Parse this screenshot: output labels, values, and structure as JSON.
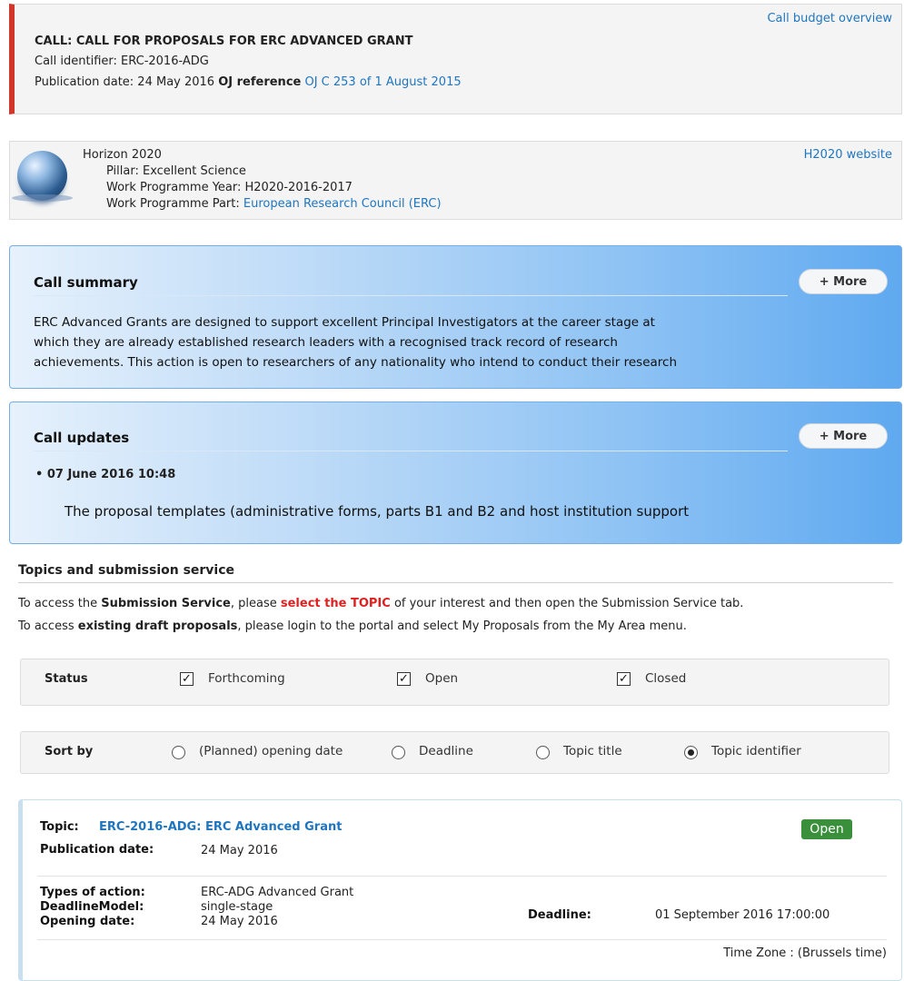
{
  "call": {
    "budget_link": "Call budget overview",
    "title": "CALL: CALL FOR PROPOSALS FOR ERC ADVANCED GRANT",
    "identifier": "Call identifier: ERC-2016-ADG",
    "publication_prefix": "Publication date: 24 May 2016",
    "oj_label": "OJ reference",
    "oj_link": "OJ C 253 of 1 August 2015"
  },
  "programme": {
    "name": "Horizon 2020",
    "pillar": "Pillar: Excellent Science",
    "wp_year": "Work Programme Year: H2020-2016-2017",
    "wp_part_label": "Work Programme Part:",
    "wp_part_link": "European Research Council (ERC)",
    "website_link": "H2020 website",
    "logo_icon": "globe-icon"
  },
  "call_summary": {
    "title": "Call summary",
    "more": "+ More",
    "lines": [
      "ERC Advanced Grants are designed to support excellent Principal Investigators at the career stage at",
      "which they are already established research leaders with a recognised track record of research",
      "achievements. This action is open to researchers of any nationality who intend to conduct their research"
    ]
  },
  "call_updates": {
    "title": "Call updates",
    "more": "+ More",
    "date": "07 June 2016 10:48",
    "text": "The proposal templates (administrative forms, parts B1 and B2 and host institution support"
  },
  "topics": {
    "title": "Topics and submission service",
    "info1_a": "To access the",
    "info1_b": "Submission Service",
    "info1_c": ", please",
    "info1_d": "select the TOPIC",
    "info1_e": "of your interest and then open the Submission Service tab.",
    "info2_a": "To access",
    "info2_b": "existing draft proposals",
    "info2_c": ", please login to the portal and select My Proposals from the My Area menu."
  },
  "status_filter": {
    "label": "Status",
    "options": [
      {
        "label": "Forthcoming",
        "checked": true
      },
      {
        "label": "Open",
        "checked": true
      },
      {
        "label": "Closed",
        "checked": true
      }
    ]
  },
  "sort_filter": {
    "label": "Sort by",
    "options": [
      {
        "label": "(Planned) opening date",
        "selected": false
      },
      {
        "label": "Deadline",
        "selected": false
      },
      {
        "label": "Topic title",
        "selected": false
      },
      {
        "label": "Topic identifier",
        "selected": true
      }
    ]
  },
  "topic": {
    "topic_label": "Topic:",
    "topic_link": "ERC-2016-ADG: ERC Advanced Grant",
    "status_badge": "Open",
    "publication_label": "Publication date:",
    "publication_value": "24 May 2016",
    "types_label": "Types of action:",
    "types_value": "ERC-ADG Advanced Grant",
    "deadline_model_label": "DeadlineModel:",
    "deadline_model_value": "single-stage",
    "opening_label": "Opening date:",
    "opening_value": "24 May 2016",
    "deadline_label": "Deadline:",
    "deadline_value": "01 September 2016 17:00:00",
    "timezone": "Time Zone : (Brussels time)",
    "badge_color": "#3a8f3a"
  },
  "colors": {
    "accent_red": "#d0362a",
    "link_blue": "#1f76bf",
    "panel_blue": "#5fa9f0"
  }
}
